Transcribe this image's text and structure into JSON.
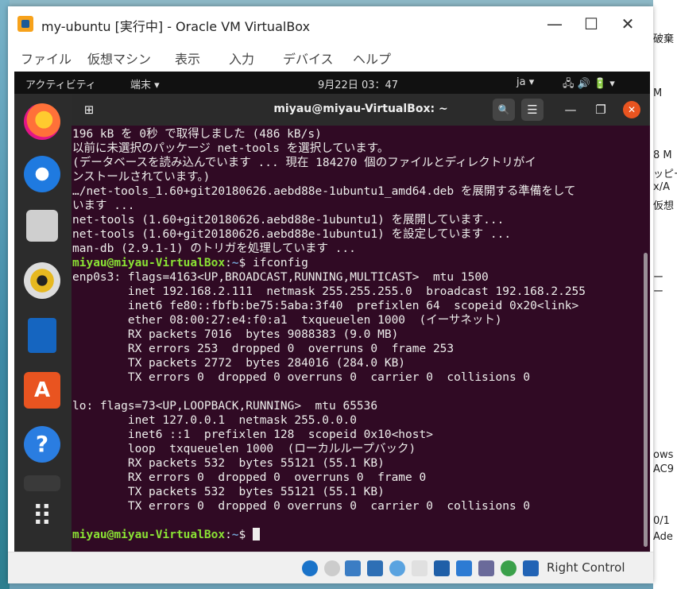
{
  "window": {
    "title": "my-ubuntu [実行中] - Oracle VM VirtualBox",
    "menu": [
      "ファイル",
      "仮想マシン",
      "表示",
      "入力",
      "デバイス",
      "ヘルプ"
    ],
    "controls": {
      "minimize": "—",
      "maximize": "☐",
      "close": "✕"
    }
  },
  "guest_topbar": {
    "activities": "アクティビティ",
    "app_menu": "端末 ▾",
    "clock": "9月22日 03：47",
    "lang": "ja ▾",
    "status_icons": "🖧  🔊  🔋 ▾"
  },
  "dock": {
    "items": [
      "firefox-icon",
      "thunderbird-icon",
      "files-icon",
      "rhythmbox-icon",
      "writer-icon",
      "software-icon",
      "help-icon",
      "terminal-icon",
      "show-apps-icon"
    ],
    "help_glyph": "?",
    "software_glyph": "A",
    "apps_glyph": "⠿"
  },
  "terminal": {
    "title": "miyau@miyau-VirtualBox: ~",
    "new_tab": "⊞",
    "search": "🔍",
    "menu": "☰",
    "minimize": "—",
    "maximize": "❐",
    "close": "✕",
    "prompt_user": "miyau@miyau-VirtualBox",
    "prompt_path": "~",
    "lines_before": [
      "196 kB を 0秒 で取得しました (486 kB/s)",
      "以前に未選択のパッケージ net-tools を選択しています。",
      "(データベースを読み込んでいます ... 現在 184270 個のファイルとディレクトリがイ",
      "ンストールされています。)",
      "…/net-tools_1.60+git20180626.aebd88e-1ubuntu1_amd64.deb を展開する準備をして",
      "います ...",
      "net-tools (1.60+git20180626.aebd88e-1ubuntu1) を展開しています...",
      "net-tools (1.60+git20180626.aebd88e-1ubuntu1) を設定しています ...",
      "man-db (2.9.1-1) のトリガを処理しています ..."
    ],
    "command": "ifconfig",
    "lines_after": [
      "enp0s3: flags=4163<UP,BROADCAST,RUNNING,MULTICAST>  mtu 1500",
      "        inet 192.168.2.111  netmask 255.255.255.0  broadcast 192.168.2.255",
      "        inet6 fe80::fbfb:be75:5aba:3f40  prefixlen 64  scopeid 0x20<link>",
      "        ether 08:00:27:e4:f0:a1  txqueuelen 1000  (イーサネット)",
      "        RX packets 7016  bytes 9088383 (9.0 MB)",
      "        RX errors 253  dropped 0  overruns 0  frame 253",
      "        TX packets 2772  bytes 284016 (284.0 KB)",
      "        TX errors 0  dropped 0 overruns 0  carrier 0  collisions 0",
      "",
      "lo: flags=73<UP,LOOPBACK,RUNNING>  mtu 65536",
      "        inet 127.0.0.1  netmask 255.0.0.0",
      "        inet6 ::1  prefixlen 128  scopeid 0x10<host>",
      "        loop  txqueuelen 1000  (ローカルループバック)",
      "        RX packets 532  bytes 55121 (55.1 KB)",
      "        RX errors 0  dropped 0  overruns 0  frame 0",
      "        TX packets 532  bytes 55121 (55.1 KB)",
      "        TX errors 0  dropped 0 overruns 0  carrier 0  collisions 0",
      ""
    ]
  },
  "statusbar": {
    "icons": [
      "hdd-icon",
      "optical-icon",
      "usb-icon",
      "network-icon",
      "audio-icon",
      "shared-folder-icon",
      "display-icon",
      "recording-icon",
      "virtualization-icon",
      "mouse-integration-icon",
      "keyboard-icon"
    ],
    "host_key": "Right Control"
  },
  "background_window": {
    "slivers": [
      "破棄",
      "M",
      "8 M",
      "ッピー",
      "x/A",
      "仮想",
      "ー",
      "ー",
      "",
      "ows",
      "AC9",
      "0/1",
      "Ade"
    ]
  }
}
